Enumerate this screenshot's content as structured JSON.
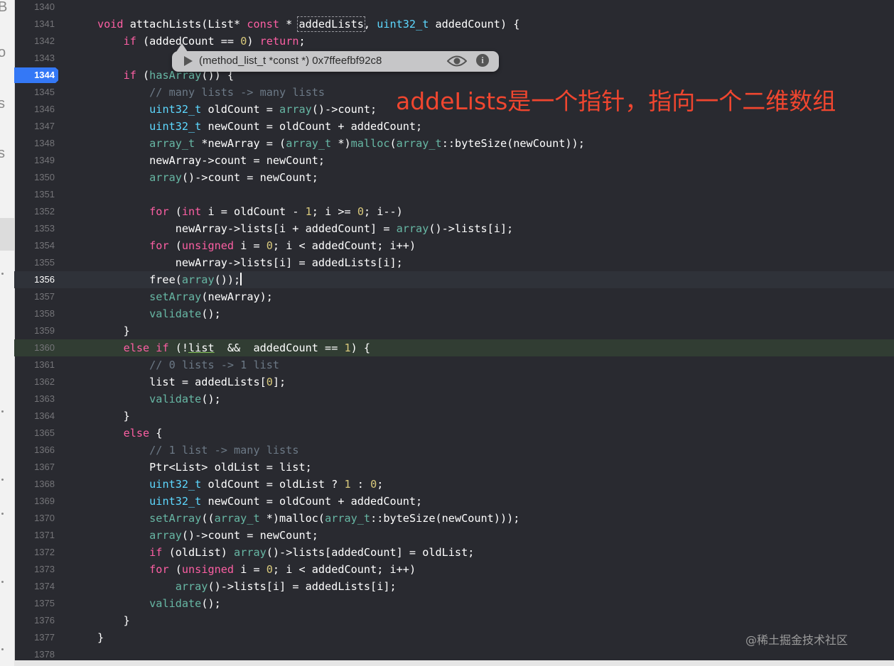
{
  "left_strip": {
    "glyphs": [
      "B",
      "o",
      "s",
      "s"
    ]
  },
  "debug_tooltip": {
    "value": "(method_list_t *const *) 0x7ffeefbf92c8",
    "icons": [
      "play-icon",
      "eye-icon",
      "info-icon"
    ]
  },
  "annotation": "addeLists是一个指针，指向一个二维数组",
  "watermark": "@稀土掘金技术社区",
  "editor": {
    "breakpoint_line": "1344",
    "current_line": "1356",
    "highlighted_line": "1360",
    "lines": [
      {
        "n": "1340",
        "t": []
      },
      {
        "n": "1341",
        "t": [
          [
            "kw",
            "void"
          ],
          [
            "pl",
            " attachLists(List* "
          ],
          [
            "kw",
            "const"
          ],
          [
            "pl",
            " * "
          ],
          [
            "box",
            "addedLists"
          ],
          [
            "pl",
            ", "
          ],
          [
            "ty",
            "uint32_t"
          ],
          [
            "pl",
            " addedCount) {"
          ]
        ]
      },
      {
        "n": "1342",
        "t": [
          [
            "pl",
            "    "
          ],
          [
            "kw",
            "if"
          ],
          [
            "pl",
            " (addedCount == "
          ],
          [
            "nm",
            "0"
          ],
          [
            "pl",
            ") "
          ],
          [
            "kw",
            "return"
          ],
          [
            "pl",
            ";"
          ]
        ]
      },
      {
        "n": "1343",
        "t": []
      },
      {
        "n": "1344",
        "t": [
          [
            "pl",
            "    "
          ],
          [
            "kw",
            "if"
          ],
          [
            "pl",
            " ("
          ],
          [
            "fn",
            "hasArray"
          ],
          [
            "pl",
            "()) {"
          ]
        ]
      },
      {
        "n": "1345",
        "t": [
          [
            "pl",
            "        "
          ],
          [
            "cm",
            "// many lists -> many lists"
          ]
        ]
      },
      {
        "n": "1346",
        "t": [
          [
            "pl",
            "        "
          ],
          [
            "ty",
            "uint32_t"
          ],
          [
            "pl",
            " oldCount = "
          ],
          [
            "fn",
            "array"
          ],
          [
            "pl",
            "()->count;"
          ]
        ]
      },
      {
        "n": "1347",
        "t": [
          [
            "pl",
            "        "
          ],
          [
            "ty",
            "uint32_t"
          ],
          [
            "pl",
            " newCount = oldCount + addedCount;"
          ]
        ]
      },
      {
        "n": "1348",
        "t": [
          [
            "pl",
            "        "
          ],
          [
            "fn",
            "array_t"
          ],
          [
            "pl",
            " *newArray = ("
          ],
          [
            "fn",
            "array_t"
          ],
          [
            "pl",
            " *)"
          ],
          [
            "fn",
            "malloc"
          ],
          [
            "pl",
            "("
          ],
          [
            "fn",
            "array_t"
          ],
          [
            "pl",
            "::byteSize(newCount));"
          ]
        ]
      },
      {
        "n": "1349",
        "t": [
          [
            "pl",
            "        newArray->count = newCount;"
          ]
        ]
      },
      {
        "n": "1350",
        "t": [
          [
            "pl",
            "        "
          ],
          [
            "fn",
            "array"
          ],
          [
            "pl",
            "()->count = newCount;"
          ]
        ]
      },
      {
        "n": "1351",
        "t": []
      },
      {
        "n": "1352",
        "t": [
          [
            "pl",
            "        "
          ],
          [
            "kw",
            "for"
          ],
          [
            "pl",
            " ("
          ],
          [
            "kw",
            "int"
          ],
          [
            "pl",
            " i = oldCount - "
          ],
          [
            "nm",
            "1"
          ],
          [
            "pl",
            "; i >= "
          ],
          [
            "nm",
            "0"
          ],
          [
            "pl",
            "; i--)"
          ]
        ]
      },
      {
        "n": "1353",
        "t": [
          [
            "pl",
            "            newArray->lists[i + addedCount] = "
          ],
          [
            "fn",
            "array"
          ],
          [
            "pl",
            "()->lists[i];"
          ]
        ]
      },
      {
        "n": "1354",
        "t": [
          [
            "pl",
            "        "
          ],
          [
            "kw",
            "for"
          ],
          [
            "pl",
            " ("
          ],
          [
            "kw",
            "unsigned"
          ],
          [
            "pl",
            " i = "
          ],
          [
            "nm",
            "0"
          ],
          [
            "pl",
            "; i < addedCount; i++)"
          ]
        ]
      },
      {
        "n": "1355",
        "t": [
          [
            "pl",
            "            newArray->lists[i] = addedLists[i];"
          ]
        ]
      },
      {
        "n": "1356",
        "t": [
          [
            "pl",
            "        free("
          ],
          [
            "fn",
            "array"
          ],
          [
            "pl",
            "());"
          ],
          [
            "caret",
            ""
          ]
        ]
      },
      {
        "n": "1357",
        "t": [
          [
            "pl",
            "        "
          ],
          [
            "fn",
            "setArray"
          ],
          [
            "pl",
            "(newArray);"
          ]
        ]
      },
      {
        "n": "1358",
        "t": [
          [
            "pl",
            "        "
          ],
          [
            "fn",
            "validate"
          ],
          [
            "pl",
            "();"
          ]
        ]
      },
      {
        "n": "1359",
        "t": [
          [
            "pl",
            "    }"
          ]
        ]
      },
      {
        "n": "1360",
        "t": [
          [
            "pl",
            "    "
          ],
          [
            "kw",
            "else if"
          ],
          [
            "pl",
            " (!"
          ],
          [
            "ul",
            "list"
          ],
          [
            "pl",
            "  &&  addedCount == "
          ],
          [
            "nm",
            "1"
          ],
          [
            "pl",
            ") {"
          ]
        ]
      },
      {
        "n": "1361",
        "t": [
          [
            "pl",
            "        "
          ],
          [
            "cm",
            "// 0 lists -> 1 list"
          ]
        ]
      },
      {
        "n": "1362",
        "t": [
          [
            "pl",
            "        list = addedLists["
          ],
          [
            "nm",
            "0"
          ],
          [
            "pl",
            "];"
          ]
        ]
      },
      {
        "n": "1363",
        "t": [
          [
            "pl",
            "        "
          ],
          [
            "fn",
            "validate"
          ],
          [
            "pl",
            "();"
          ]
        ]
      },
      {
        "n": "1364",
        "t": [
          [
            "pl",
            "    }"
          ]
        ]
      },
      {
        "n": "1365",
        "t": [
          [
            "pl",
            "    "
          ],
          [
            "kw",
            "else"
          ],
          [
            "pl",
            " {"
          ]
        ]
      },
      {
        "n": "1366",
        "t": [
          [
            "pl",
            "        "
          ],
          [
            "cm",
            "// 1 list -> many lists"
          ]
        ]
      },
      {
        "n": "1367",
        "t": [
          [
            "pl",
            "        Ptr<List> oldList = list;"
          ]
        ]
      },
      {
        "n": "1368",
        "t": [
          [
            "pl",
            "        "
          ],
          [
            "ty",
            "uint32_t"
          ],
          [
            "pl",
            " oldCount = oldList ? "
          ],
          [
            "nm",
            "1"
          ],
          [
            "pl",
            " : "
          ],
          [
            "nm",
            "0"
          ],
          [
            "pl",
            ";"
          ]
        ]
      },
      {
        "n": "1369",
        "t": [
          [
            "pl",
            "        "
          ],
          [
            "ty",
            "uint32_t"
          ],
          [
            "pl",
            " newCount = oldCount + addedCount;"
          ]
        ]
      },
      {
        "n": "1370",
        "t": [
          [
            "pl",
            "        "
          ],
          [
            "fn",
            "setArray"
          ],
          [
            "pl",
            "(("
          ],
          [
            "fn",
            "array_t"
          ],
          [
            "pl",
            " *)malloc("
          ],
          [
            "fn",
            "array_t"
          ],
          [
            "pl",
            "::byteSize(newCount)));"
          ]
        ]
      },
      {
        "n": "1371",
        "t": [
          [
            "pl",
            "        "
          ],
          [
            "fn",
            "array"
          ],
          [
            "pl",
            "()->count = newCount;"
          ]
        ]
      },
      {
        "n": "1372",
        "t": [
          [
            "pl",
            "        "
          ],
          [
            "kw",
            "if"
          ],
          [
            "pl",
            " (oldList) "
          ],
          [
            "fn",
            "array"
          ],
          [
            "pl",
            "()->lists[addedCount] = oldList;"
          ]
        ]
      },
      {
        "n": "1373",
        "t": [
          [
            "pl",
            "        "
          ],
          [
            "kw",
            "for"
          ],
          [
            "pl",
            " ("
          ],
          [
            "kw",
            "unsigned"
          ],
          [
            "pl",
            " i = "
          ],
          [
            "nm",
            "0"
          ],
          [
            "pl",
            "; i < addedCount; i++)"
          ]
        ]
      },
      {
        "n": "1374",
        "t": [
          [
            "pl",
            "            "
          ],
          [
            "fn",
            "array"
          ],
          [
            "pl",
            "()->lists[i] = addedLists[i];"
          ]
        ]
      },
      {
        "n": "1375",
        "t": [
          [
            "pl",
            "        "
          ],
          [
            "fn",
            "validate"
          ],
          [
            "pl",
            "();"
          ]
        ]
      },
      {
        "n": "1376",
        "t": [
          [
            "pl",
            "    }"
          ]
        ]
      },
      {
        "n": "1377",
        "t": [
          [
            "pl",
            "}"
          ]
        ]
      },
      {
        "n": "1378",
        "t": []
      }
    ]
  }
}
